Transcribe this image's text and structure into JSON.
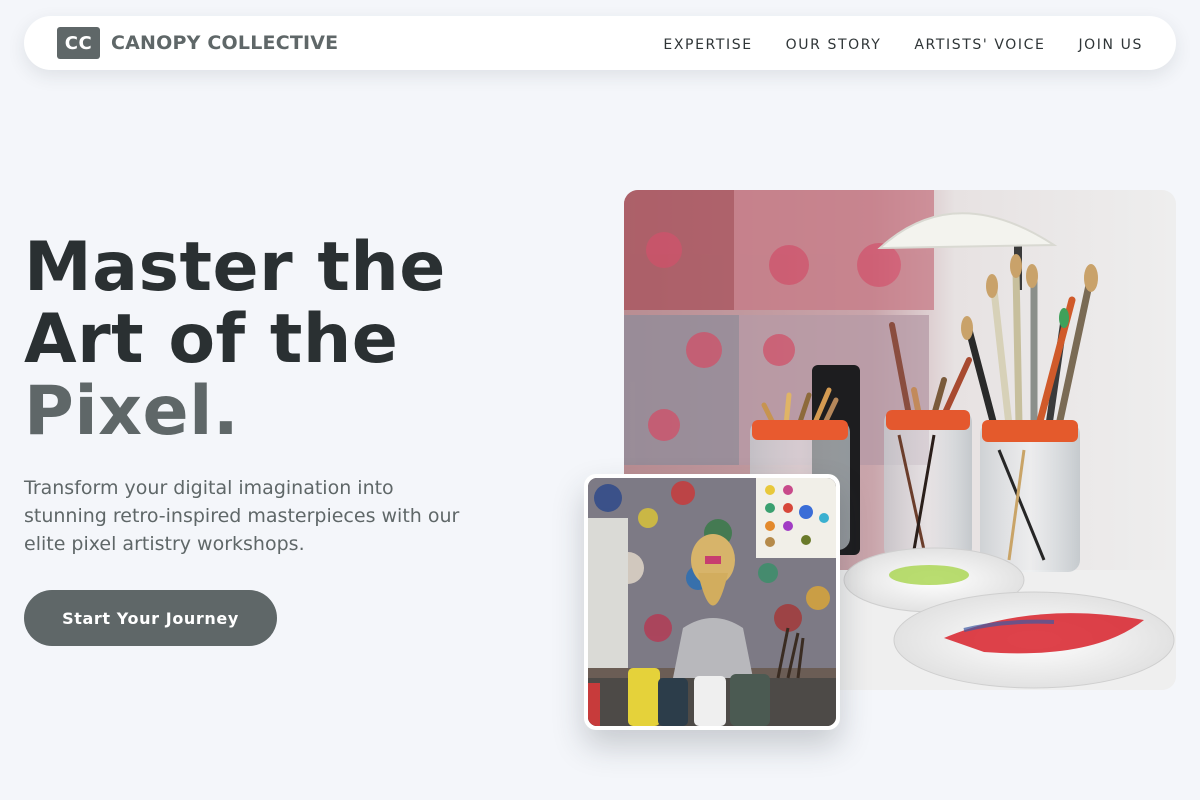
{
  "brand": {
    "logo_text": "CC",
    "name": "CANOPY COLLECTIVE"
  },
  "nav": {
    "items": [
      {
        "label": "EXPERTISE"
      },
      {
        "label": "OUR STORY"
      },
      {
        "label": "ARTISTS' VOICE"
      },
      {
        "label": "JOIN US"
      }
    ]
  },
  "hero": {
    "title_line1": "Master the",
    "title_line2": "Art of the",
    "title_accent": "Pixel.",
    "subtitle": "Transform your digital imagination into stunning retro-inspired masterpieces with our elite pixel artistry workshops.",
    "cta_label": "Start Your Journey"
  },
  "images": {
    "main": {
      "icon": "paintbrush-jars-photo"
    },
    "inset": {
      "icon": "child-painting-photo"
    }
  },
  "colors": {
    "background": "#f4f6fa",
    "primary": "#5f6768",
    "heading": "#2a3032",
    "surface": "#ffffff"
  }
}
